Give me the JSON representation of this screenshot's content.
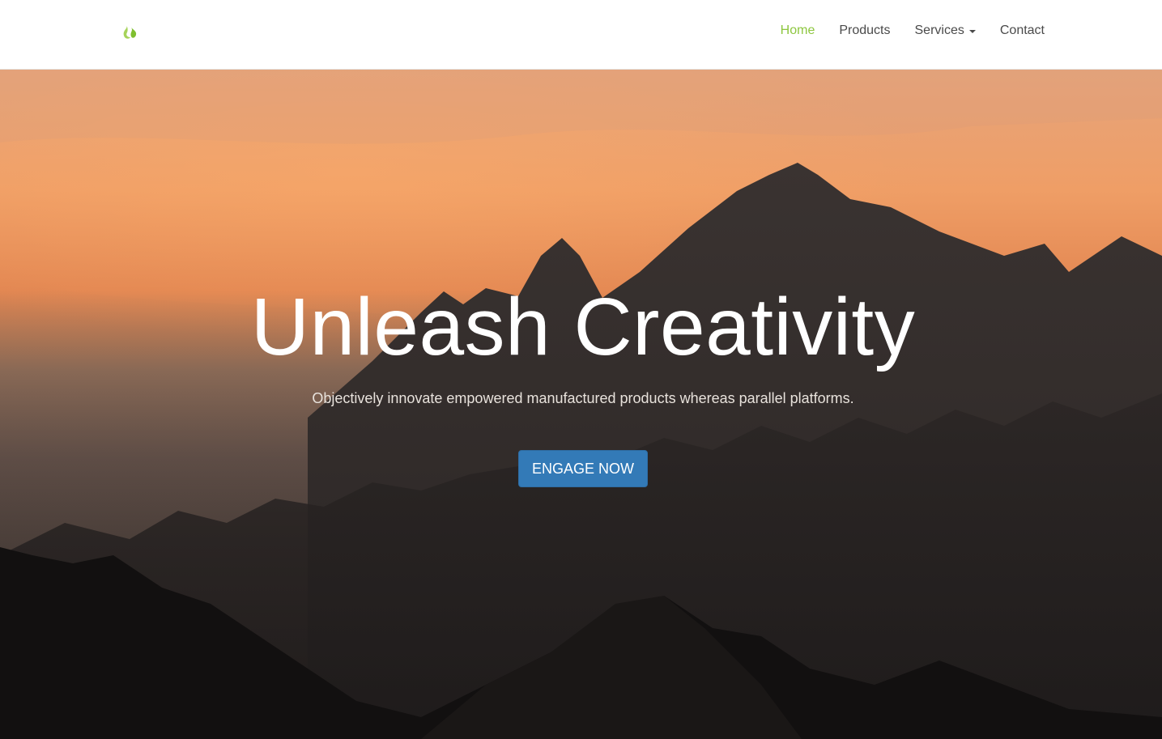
{
  "navbar": {
    "logo_icon": "flame-icon",
    "items": [
      {
        "label": "Home",
        "active": true
      },
      {
        "label": "Products",
        "active": false
      },
      {
        "label": "Services",
        "active": false,
        "has_dropdown": true
      },
      {
        "label": "Contact",
        "active": false
      }
    ]
  },
  "hero": {
    "background": "mountain-sunset-photo",
    "headline": "Unleash Creativity",
    "subtext": "Objectively innovate empowered manufactured products whereas parallel platforms.",
    "cta_label": "ENGAGE NOW"
  },
  "colors": {
    "accent": "#8dc63f",
    "nav_text": "#4a4a4a",
    "button": "#337ab7",
    "headline": "#ffffff"
  }
}
